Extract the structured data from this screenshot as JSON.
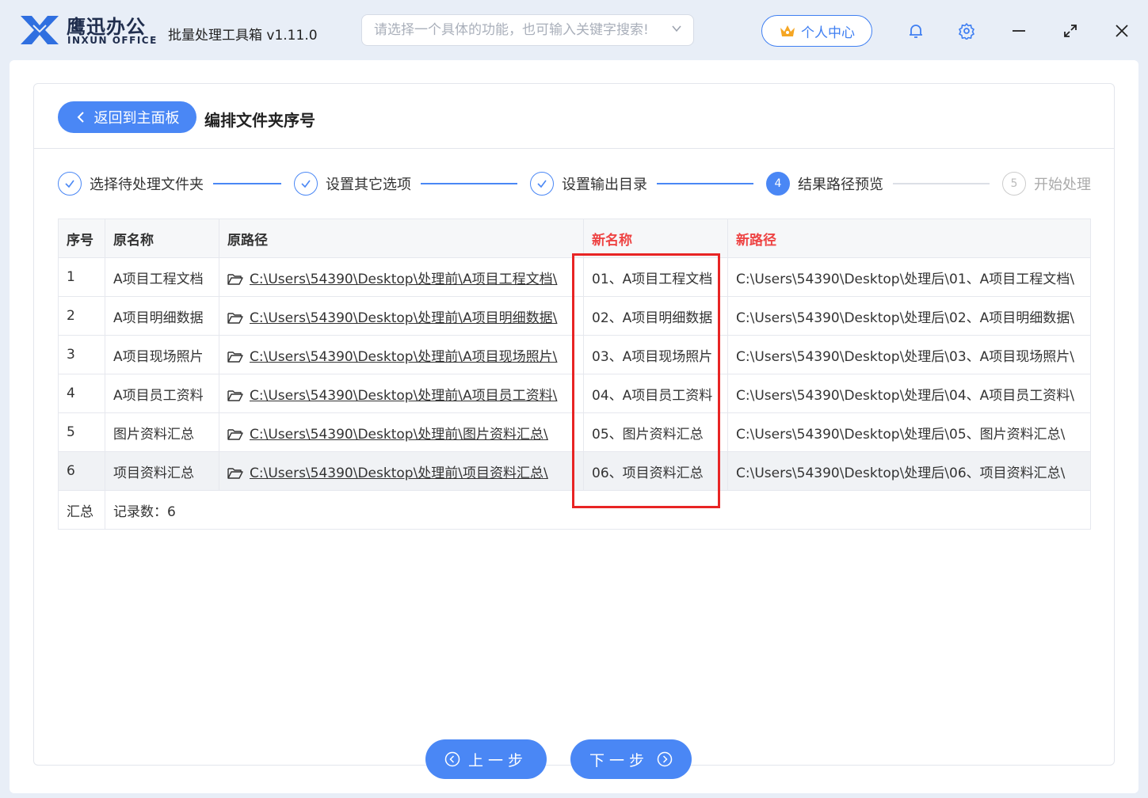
{
  "app": {
    "brand_cn": "鹰迅办公",
    "brand_en": "INXUN OFFICE",
    "title": "批量处理工具箱 v1.11.0",
    "search_placeholder": "请选择一个具体的功能，也可输入关键字搜索!",
    "user_center": "个人中心"
  },
  "header": {
    "back_label": "返回到主面板",
    "page_title": "编排文件夹序号"
  },
  "steps": [
    {
      "num": "✓",
      "label": "选择待处理文件夹",
      "state": "done"
    },
    {
      "num": "✓",
      "label": "设置其它选项",
      "state": "done"
    },
    {
      "num": "✓",
      "label": "设置输出目录",
      "state": "done"
    },
    {
      "num": "4",
      "label": "结果路径预览",
      "state": "active"
    },
    {
      "num": "5",
      "label": "开始处理",
      "state": "pending"
    }
  ],
  "table": {
    "headers": [
      "序号",
      "原名称",
      "原路径",
      "新名称",
      "新路径"
    ],
    "rows": [
      {
        "idx": "1",
        "name": "A项目工程文档",
        "path": "C:\\Users\\54390\\Desktop\\处理前\\A项目工程文档\\",
        "new_name": "01、A项目工程文档",
        "new_path": "C:\\Users\\54390\\Desktop\\处理后\\01、A项目工程文档\\"
      },
      {
        "idx": "2",
        "name": "A项目明细数据",
        "path": "C:\\Users\\54390\\Desktop\\处理前\\A项目明细数据\\",
        "new_name": "02、A项目明细数据",
        "new_path": "C:\\Users\\54390\\Desktop\\处理后\\02、A项目明细数据\\"
      },
      {
        "idx": "3",
        "name": "A项目现场照片",
        "path": "C:\\Users\\54390\\Desktop\\处理前\\A项目现场照片\\",
        "new_name": "03、A项目现场照片",
        "new_path": "C:\\Users\\54390\\Desktop\\处理后\\03、A项目现场照片\\"
      },
      {
        "idx": "4",
        "name": "A项目员工资料",
        "path": "C:\\Users\\54390\\Desktop\\处理前\\A项目员工资料\\",
        "new_name": "04、A项目员工资料",
        "new_path": "C:\\Users\\54390\\Desktop\\处理后\\04、A项目员工资料\\"
      },
      {
        "idx": "5",
        "name": "图片资料汇总",
        "path": "C:\\Users\\54390\\Desktop\\处理前\\图片资料汇总\\",
        "new_name": "05、图片资料汇总",
        "new_path": "C:\\Users\\54390\\Desktop\\处理后\\05、图片资料汇总\\"
      },
      {
        "idx": "6",
        "name": "项目资料汇总",
        "path": "C:\\Users\\54390\\Desktop\\处理前\\项目资料汇总\\",
        "new_name": "06、项目资料汇总",
        "new_path": "C:\\Users\\54390\\Desktop\\处理后\\06、项目资料汇总\\"
      }
    ],
    "summary_label": "汇总",
    "summary_value": "记录数：6"
  },
  "footer": {
    "prev_label": "上一步",
    "next_label": "下一步"
  },
  "colors": {
    "accent": "#4a87f5",
    "highlight_red": "#e82424",
    "header_red": "#ee4444"
  }
}
